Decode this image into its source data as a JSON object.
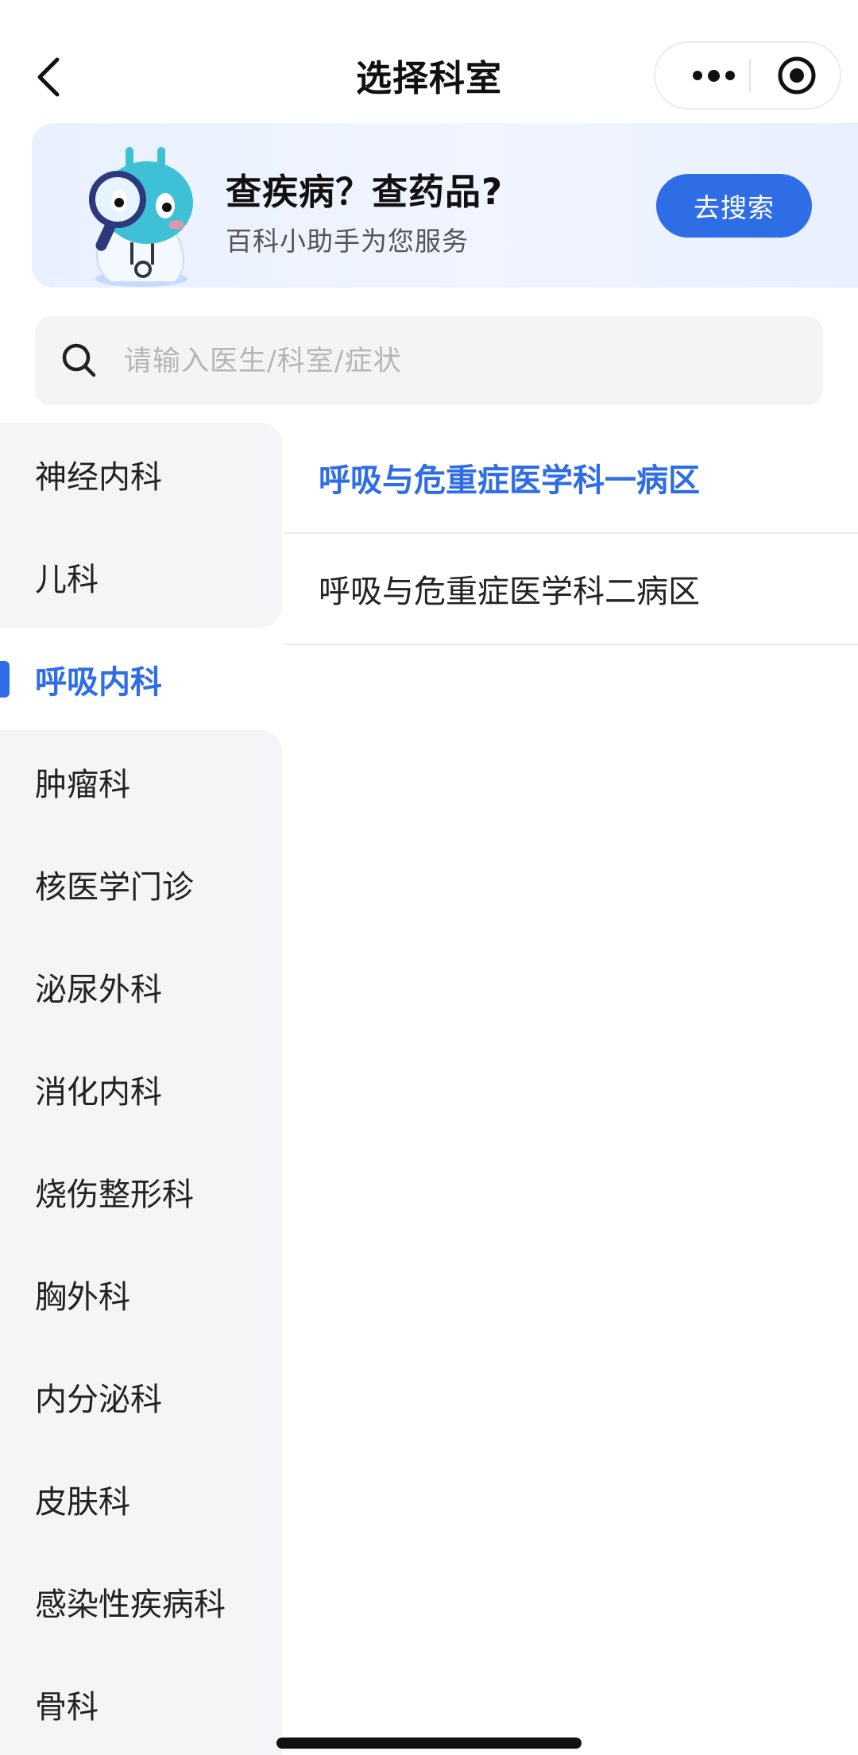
{
  "navbar": {
    "title": "选择科室",
    "back_icon": "chevron-left-icon",
    "more_icon": "more-dots-icon",
    "close_icon": "target-close-icon"
  },
  "banner": {
    "title": "查疾病？查药品?",
    "subtitle": "百科小助手为您服务",
    "button_label": "去搜索",
    "accent_color": "#2f6de6"
  },
  "search": {
    "placeholder": "请输入医生/科室/症状",
    "value": ""
  },
  "sidebar": {
    "selected_index": 2,
    "items": [
      {
        "label": "神经内科"
      },
      {
        "label": "儿科"
      },
      {
        "label": "呼吸内科"
      },
      {
        "label": "肿瘤科"
      },
      {
        "label": "核医学门诊"
      },
      {
        "label": "泌尿外科"
      },
      {
        "label": "消化内科"
      },
      {
        "label": "烧伤整形科"
      },
      {
        "label": "胸外科"
      },
      {
        "label": "内分泌科"
      },
      {
        "label": "皮肤科"
      },
      {
        "label": "感染性疾病科"
      },
      {
        "label": "骨科"
      }
    ]
  },
  "wards": {
    "selected_index": 0,
    "items": [
      {
        "label": "呼吸与危重症医学科一病区"
      },
      {
        "label": "呼吸与危重症医学科二病区"
      }
    ]
  }
}
